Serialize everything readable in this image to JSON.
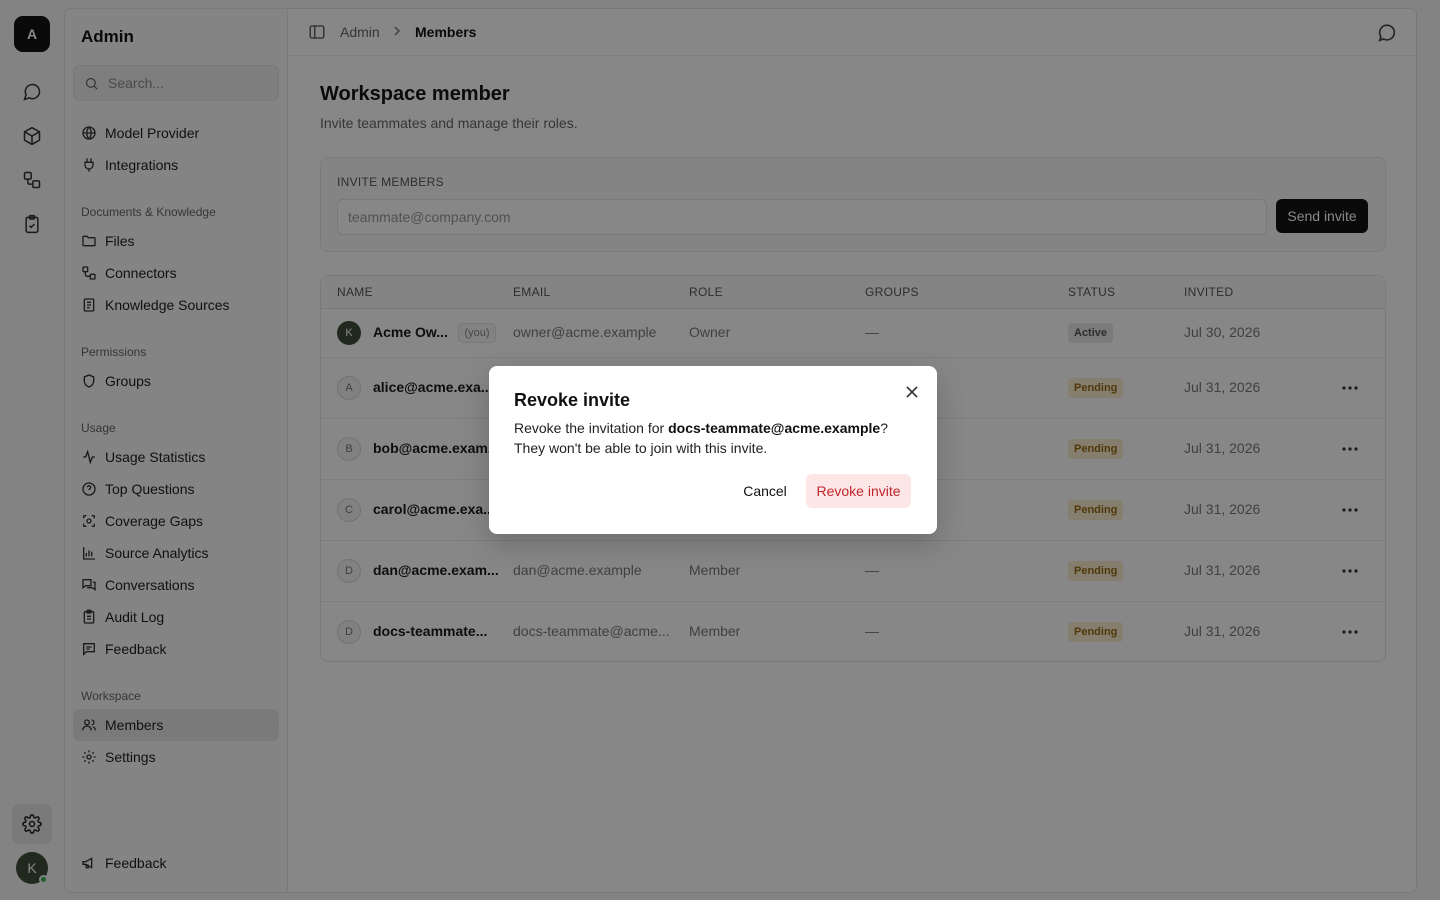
{
  "rail": {
    "logo_letter": "A",
    "icons": [
      "chat-icon",
      "box-icon",
      "workflow-icon",
      "clipboard-check-icon"
    ],
    "settings_icon": "gear-icon",
    "user_avatar_letter": "K"
  },
  "sidebar": {
    "title": "Admin",
    "search_placeholder": "Search...",
    "top_items": [
      {
        "label": "Model Provider",
        "icon": "globe-icon"
      },
      {
        "label": "Integrations",
        "icon": "plug-icon"
      }
    ],
    "sections": [
      {
        "title": "Documents & Knowledge",
        "items": [
          {
            "label": "Files",
            "icon": "folder-icon"
          },
          {
            "label": "Connectors",
            "icon": "connector-icon"
          },
          {
            "label": "Knowledge Sources",
            "icon": "book-icon"
          }
        ]
      },
      {
        "title": "Permissions",
        "items": [
          {
            "label": "Groups",
            "icon": "shield-icon"
          }
        ]
      },
      {
        "title": "Usage",
        "items": [
          {
            "label": "Usage Statistics",
            "icon": "activity-icon"
          },
          {
            "label": "Top Questions",
            "icon": "help-circle-icon"
          },
          {
            "label": "Coverage Gaps",
            "icon": "scan-icon"
          },
          {
            "label": "Source Analytics",
            "icon": "bar-chart-icon"
          },
          {
            "label": "Conversations",
            "icon": "messages-icon"
          },
          {
            "label": "Audit Log",
            "icon": "clipboard-icon"
          },
          {
            "label": "Feedback",
            "icon": "message-square-icon"
          }
        ]
      },
      {
        "title": "Workspace",
        "items": [
          {
            "label": "Members",
            "icon": "users-icon",
            "active": true
          },
          {
            "label": "Settings",
            "icon": "gear-icon"
          }
        ]
      }
    ],
    "footer_feedback": "Feedback"
  },
  "topbar": {
    "breadcrumb_parent": "Admin",
    "breadcrumb_separator": ">",
    "breadcrumb_current": "Members"
  },
  "page": {
    "title": "Workspace member",
    "subtitle": "Invite teammates and manage their roles."
  },
  "invite": {
    "label": "INVITE MEMBERS",
    "placeholder": "teammate@company.com",
    "button": "Send invite"
  },
  "table": {
    "headers": [
      "NAME",
      "EMAIL",
      "ROLE",
      "GROUPS",
      "STATUS",
      "INVITED"
    ],
    "rows": [
      {
        "avatar": "K",
        "name": "Acme Ow...",
        "you": "(you)",
        "email": "owner@acme.example",
        "role": "Owner",
        "groups": "—",
        "status": "Active",
        "invited": "Jul 30, 2026"
      },
      {
        "avatar": "A",
        "name": "alice@acme.exa...",
        "email": "",
        "role": "",
        "groups": "",
        "status": "Pending",
        "invited": "Jul 31, 2026"
      },
      {
        "avatar": "B",
        "name": "bob@acme.exam...",
        "email": "",
        "role": "",
        "groups": "",
        "status": "Pending",
        "invited": "Jul 31, 2026"
      },
      {
        "avatar": "C",
        "name": "carol@acme.exa...",
        "email": "",
        "role": "",
        "groups": "",
        "status": "Pending",
        "invited": "Jul 31, 2026"
      },
      {
        "avatar": "D",
        "name": "dan@acme.exam...",
        "email": "dan@acme.example",
        "role": "Member",
        "groups": "—",
        "status": "Pending",
        "invited": "Jul 31, 2026"
      },
      {
        "avatar": "D",
        "name": "docs-teammate...",
        "email": "docs-teammate@acme...",
        "role": "Member",
        "groups": "—",
        "status": "Pending",
        "invited": "Jul 31, 2026"
      }
    ]
  },
  "dialog": {
    "title": "Revoke invite",
    "body_prefix": "Revoke the invitation for ",
    "body_email": "docs-teammate@acme.example",
    "body_suffix": "?",
    "body_line2": "They won't be able to join with this invite.",
    "cancel": "Cancel",
    "confirm": "Revoke invite"
  },
  "colors": {
    "accent_dark": "#141414",
    "danger_text": "#c0262d",
    "danger_bg": "#fde6e6",
    "pending_bg": "#fbeed2",
    "pending_text": "#9a6a12",
    "online": "#3bb25e"
  }
}
